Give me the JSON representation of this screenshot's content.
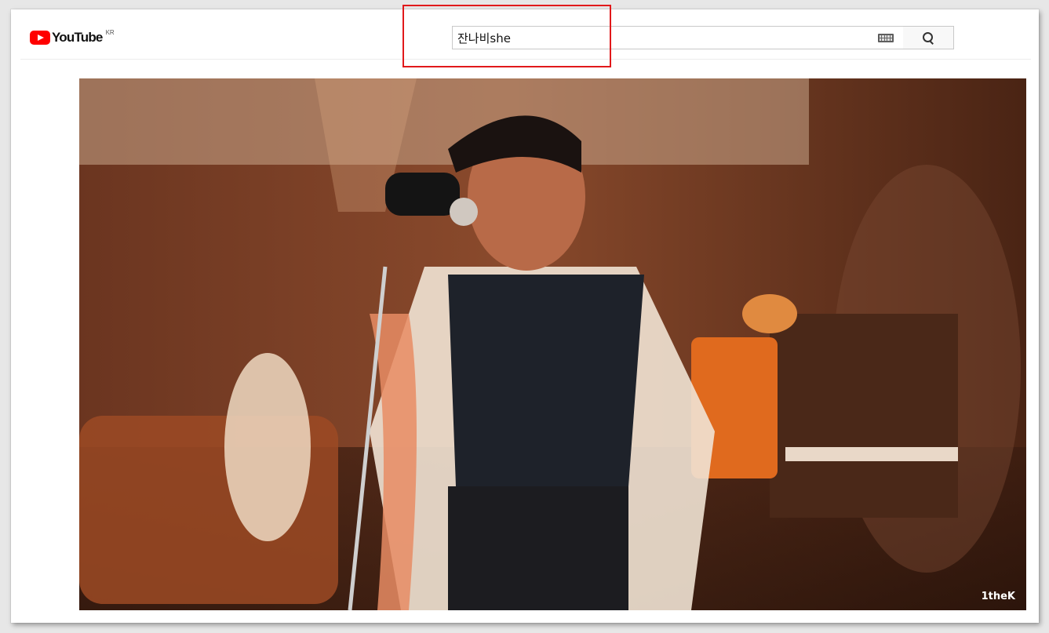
{
  "masthead": {
    "logo_text": "YouTube",
    "region": "KR"
  },
  "search": {
    "query": "잔나비she"
  },
  "player": {
    "watermark": "1theK"
  },
  "colors": {
    "brand_red": "#ff0000",
    "highlight_red": "#e1191b"
  },
  "icons": [
    "youtube-logo-icon",
    "keyboard-icon",
    "search-icon"
  ]
}
